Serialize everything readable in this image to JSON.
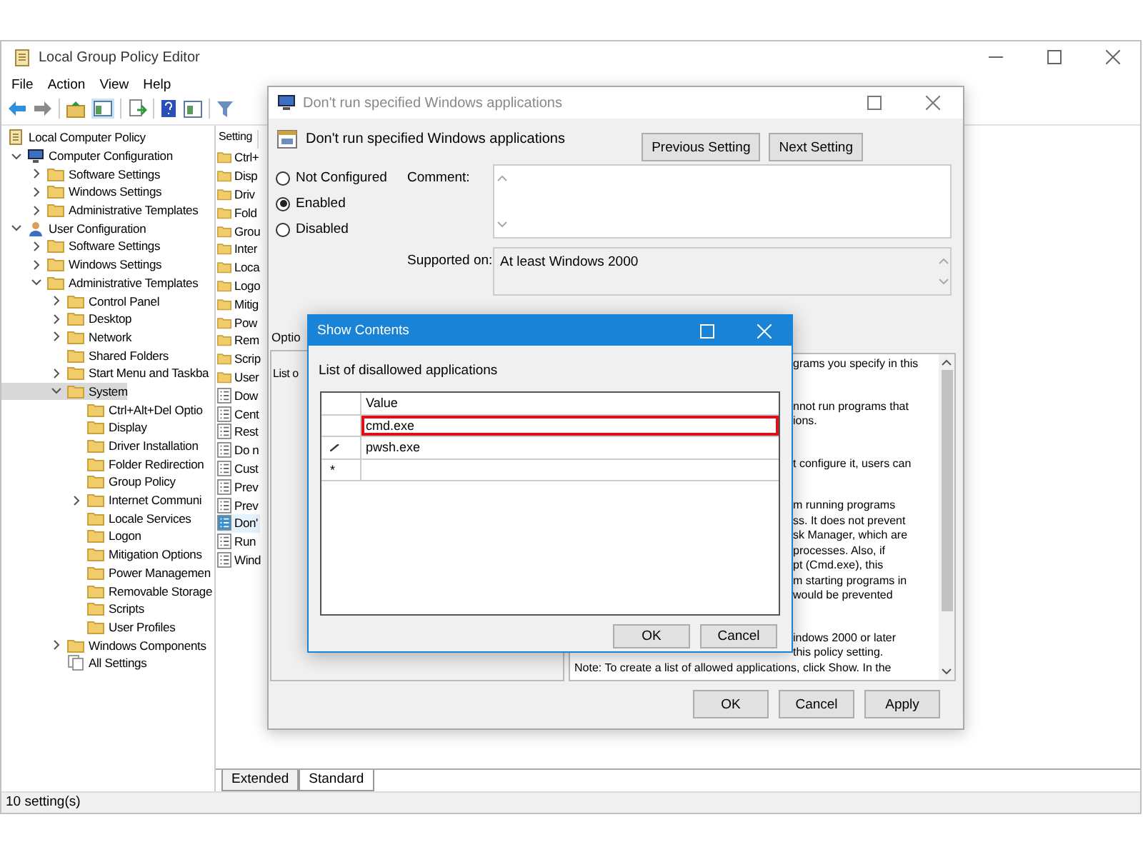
{
  "window": {
    "title": "Local Group Policy Editor"
  },
  "menu": [
    "File",
    "Action",
    "View",
    "Help"
  ],
  "tree": [
    {
      "label": "Local Computer Policy",
      "kind": "policy",
      "selected": false,
      "children": [
        {
          "label": "Computer Configuration",
          "kind": "computer",
          "expanded": true,
          "selected": false,
          "children": [
            {
              "label": "Software Settings",
              "kind": "folder",
              "expanded": false,
              "selected": false
            },
            {
              "label": "Windows Settings",
              "kind": "folder",
              "expanded": false,
              "selected": false
            },
            {
              "label": "Administrative Templates",
              "kind": "folder",
              "expanded": false,
              "selected": false
            }
          ]
        },
        {
          "label": "User Configuration",
          "kind": "user",
          "expanded": true,
          "selected": false,
          "children": [
            {
              "label": "Software Settings",
              "kind": "folder",
              "expanded": false,
              "selected": false
            },
            {
              "label": "Windows Settings",
              "kind": "folder",
              "expanded": false,
              "selected": false
            },
            {
              "label": "Administrative Templates",
              "kind": "folder",
              "expanded": true,
              "selected": false,
              "children": [
                {
                  "label": "Control Panel",
                  "kind": "folder",
                  "expanded": false,
                  "selected": false
                },
                {
                  "label": "Desktop",
                  "kind": "folder",
                  "expanded": false,
                  "selected": false
                },
                {
                  "label": "Network",
                  "kind": "folder",
                  "expanded": false,
                  "selected": false
                },
                {
                  "label": "Shared Folders",
                  "kind": "folder",
                  "selected": false
                },
                {
                  "label": "Start Menu and Taskba",
                  "kind": "folder",
                  "expanded": false,
                  "selected": false
                },
                {
                  "label": "System",
                  "kind": "folder",
                  "expanded": true,
                  "selected": true,
                  "children": [
                    {
                      "label": "Ctrl+Alt+Del Optio",
                      "kind": "folder",
                      "selected": false
                    },
                    {
                      "label": "Display",
                      "kind": "folder",
                      "selected": false
                    },
                    {
                      "label": "Driver Installation",
                      "kind": "folder",
                      "selected": false
                    },
                    {
                      "label": "Folder Redirection",
                      "kind": "folder",
                      "selected": false
                    },
                    {
                      "label": "Group Policy",
                      "kind": "folder",
                      "selected": false
                    },
                    {
                      "label": "Internet Communi",
                      "kind": "folder",
                      "expanded": false,
                      "selected": false
                    },
                    {
                      "label": "Locale Services",
                      "kind": "folder",
                      "selected": false
                    },
                    {
                      "label": "Logon",
                      "kind": "folder",
                      "selected": false
                    },
                    {
                      "label": "Mitigation Options",
                      "kind": "folder",
                      "selected": false
                    },
                    {
                      "label": "Power Managemen",
                      "kind": "folder",
                      "selected": false
                    },
                    {
                      "label": "Removable Storage",
                      "kind": "folder",
                      "selected": false
                    },
                    {
                      "label": "Scripts",
                      "kind": "folder",
                      "selected": false
                    },
                    {
                      "label": "User Profiles",
                      "kind": "folder",
                      "selected": false
                    }
                  ]
                },
                {
                  "label": "Windows Components",
                  "kind": "folder",
                  "expanded": false,
                  "selected": false
                },
                {
                  "label": "All Settings",
                  "kind": "all",
                  "selected": false
                }
              ]
            }
          ]
        }
      ]
    }
  ],
  "settings_list": {
    "column": "Setting",
    "items": [
      {
        "label": "Ctrl+",
        "kind": "folder",
        "selected": false
      },
      {
        "label": "Disp",
        "kind": "folder",
        "selected": false
      },
      {
        "label": "Driv",
        "kind": "folder",
        "selected": false
      },
      {
        "label": "Fold",
        "kind": "folder",
        "selected": false
      },
      {
        "label": "Grou",
        "kind": "folder",
        "selected": false
      },
      {
        "label": "Inter",
        "kind": "folder",
        "selected": false
      },
      {
        "label": "Loca",
        "kind": "folder",
        "selected": false
      },
      {
        "label": "Logo",
        "kind": "folder",
        "selected": false
      },
      {
        "label": "Mitig",
        "kind": "folder",
        "selected": false
      },
      {
        "label": "Pow",
        "kind": "folder",
        "selected": false
      },
      {
        "label": "Rem",
        "kind": "folder",
        "selected": false
      },
      {
        "label": "Scrip",
        "kind": "folder",
        "selected": false
      },
      {
        "label": "User",
        "kind": "folder",
        "selected": false
      },
      {
        "label": "Dow",
        "kind": "policy",
        "selected": false
      },
      {
        "label": "Cent",
        "kind": "policy",
        "selected": false
      },
      {
        "label": "Rest",
        "kind": "policy",
        "selected": false
      },
      {
        "label": "Do n",
        "kind": "policy",
        "selected": false
      },
      {
        "label": "Cust",
        "kind": "policy",
        "selected": false
      },
      {
        "label": "Prev",
        "kind": "policy",
        "selected": false
      },
      {
        "label": "Prev",
        "kind": "policy",
        "selected": false
      },
      {
        "label": "Don'",
        "kind": "policy",
        "selected": true
      },
      {
        "label": "Run",
        "kind": "policy",
        "selected": false
      },
      {
        "label": "Wind",
        "kind": "policy",
        "selected": false
      }
    ]
  },
  "view_tabs": [
    {
      "label": "Extended",
      "selected": false
    },
    {
      "label": "Standard",
      "selected": true
    }
  ],
  "status_bar": "10 setting(s)",
  "policy_dialog": {
    "title": "Don't run specified Windows applications",
    "heading": "Don't run specified Windows applications",
    "nav_buttons": [
      "Previous Setting",
      "Next Setting"
    ],
    "states": [
      {
        "label": "Not Configured",
        "selected": false
      },
      {
        "label": "Enabled",
        "selected": true
      },
      {
        "label": "Disabled",
        "selected": false
      }
    ],
    "comment_label": "Comment:",
    "supported_label": "Supported on:",
    "supported_value": "At least Windows 2000",
    "options_label": "Optio",
    "options_text": "List o",
    "help_paragraphs": [
      {
        "lines": [
          {
            "text": "grams you specify in this",
            "kind": "covered"
          }
        ]
      },
      {
        "lines": [
          {
            "text": "nnot run programs that",
            "kind": "covered"
          },
          {
            "text": "ions.",
            "kind": "covered"
          }
        ]
      },
      {
        "lines": [
          {
            "text": "t configure it, users can",
            "kind": "covered"
          }
        ]
      },
      {
        "lines": [
          {
            "text": "m running programs",
            "kind": "covered"
          },
          {
            "text": "ss. It does not prevent",
            "kind": "covered"
          },
          {
            "text": "sk Manager, which are",
            "kind": "covered"
          },
          {
            "text": "processes.  Also, if",
            "kind": "covered"
          },
          {
            "text": "pt (Cmd.exe), this",
            "kind": "covered"
          },
          {
            "text": "m starting programs in",
            "kind": "covered"
          },
          {
            "text": "would be prevented",
            "kind": "covered"
          }
        ]
      },
      {
        "lines": [
          {
            "text": "indows 2000 or later",
            "kind": "covered"
          },
          {
            "text": "this policy setting.",
            "kind": "covered"
          },
          {
            "text": "Note: To create a list of allowed applications, click Show.  In the",
            "kind": "full"
          }
        ]
      }
    ],
    "buttons": [
      "OK",
      "Cancel",
      "Apply"
    ]
  },
  "show_contents": {
    "title": "Show Contents",
    "label": "List of disallowed applications",
    "column": "Value",
    "rows": [
      {
        "kind": "value",
        "value": "cmd.exe",
        "selected": true
      },
      {
        "kind": "editing",
        "value": "pwsh.exe",
        "selected": false
      },
      {
        "kind": "new",
        "marker": "*",
        "selected": false
      }
    ],
    "buttons": [
      "OK",
      "Cancel"
    ]
  }
}
